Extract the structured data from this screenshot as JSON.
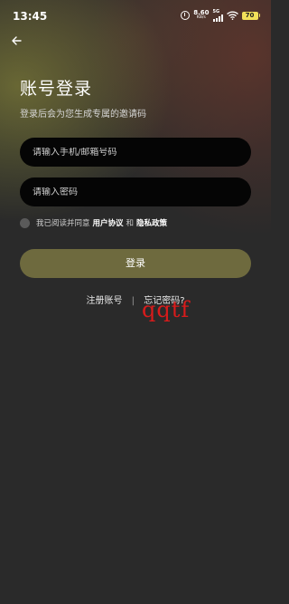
{
  "status_bar": {
    "time": "13:45",
    "net_speed_value": "8.60",
    "net_speed_unit": "KB/s",
    "network_type": "5G",
    "battery": "70"
  },
  "header": {
    "title": "账号登录",
    "subtitle": "登录后会为您生成专属的邀请码"
  },
  "form": {
    "phone_placeholder": "请输入手机/邮箱号码",
    "password_placeholder": "请输入密码"
  },
  "agreement": {
    "prefix": "我已阅读并同意",
    "user_agreement": "用户协议",
    "conjunction": "和",
    "privacy_policy": "隐私政策"
  },
  "login_button": "登录",
  "links": {
    "register": "注册账号",
    "separator": "|",
    "forgot": "忘记密码?"
  },
  "watermark": "qqtf",
  "colors": {
    "background": "#2a2a2a",
    "input_bg": "#050505",
    "button_bg": "#6e6a3e",
    "battery": "#f2e05a",
    "watermark": "#d91b1b"
  },
  "icons": {
    "back": "back-arrow-icon",
    "alarm": "alarm-icon",
    "signal": "signal-icon",
    "wifi": "wifi-icon",
    "battery": "battery-icon"
  }
}
